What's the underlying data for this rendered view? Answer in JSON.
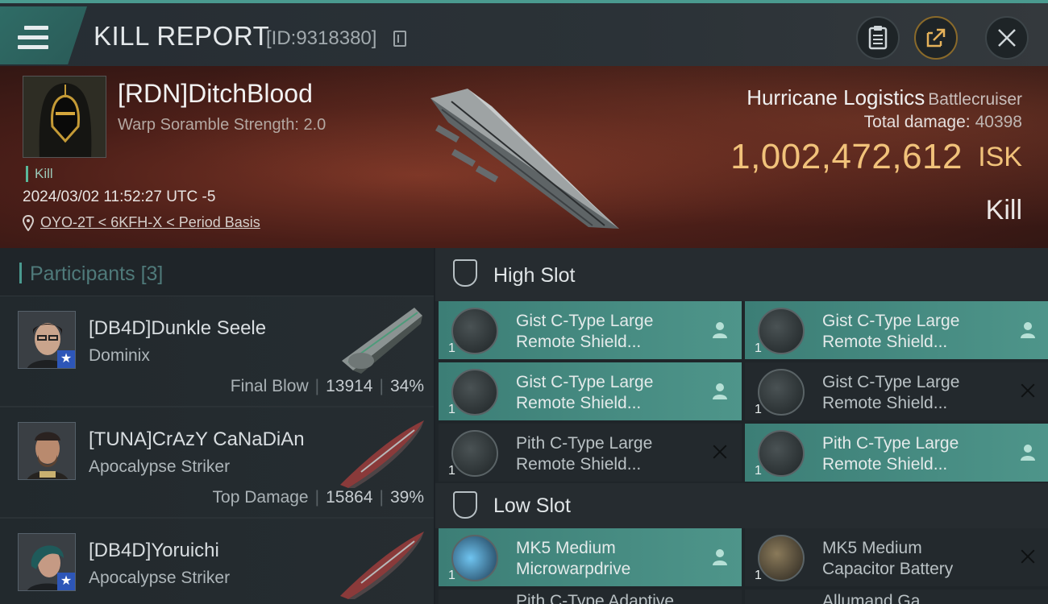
{
  "header": {
    "title": "KILL REPORT",
    "report_id": "[ID:9318380]"
  },
  "victim": {
    "name": "[RDN]DitchBlood",
    "scramble": "Warp Soramble Strength: 2.0",
    "kill_tag": "Kill",
    "datetime": "2024/03/02 11:52:27 UTC -5",
    "location": "OYO-2T < 6KFH-X < Period Basis",
    "ship_name": "Hurricane Logistics",
    "ship_class": "Battlecruiser",
    "total_damage_label": "Total damage:",
    "total_damage": "40398",
    "isk_value": "1,002,472,612",
    "isk_unit": "ISK",
    "result": "Kill"
  },
  "participants": {
    "label": "Participants",
    "count": "[3]",
    "rows": [
      {
        "name": "[DB4D]Dunkle Seele",
        "ship": "Dominix",
        "stat_label": "Final Blow",
        "damage": "13914",
        "percent": "34%"
      },
      {
        "name": "[TUNA]CrAzY CaNaDiAn",
        "ship": "Apocalypse Striker",
        "stat_label": "Top Damage",
        "damage": "15864",
        "percent": "39%"
      },
      {
        "name": "[DB4D]Yoruichi",
        "ship": "Apocalypse Striker"
      }
    ]
  },
  "high_slot": {
    "label": "High Slot",
    "items": [
      {
        "line1": "Gist C-Type Large",
        "line2": "Remote Shield...",
        "qty": "1",
        "state": "on",
        "status": "person-icon"
      },
      {
        "line1": "Gist C-Type Large",
        "line2": "Remote Shield...",
        "qty": "1",
        "state": "on",
        "status": "person-icon"
      },
      {
        "line1": "Gist C-Type Large",
        "line2": "Remote Shield...",
        "qty": "1",
        "state": "on",
        "status": "person-icon"
      },
      {
        "line1": "Gist C-Type Large",
        "line2": "Remote Shield...",
        "qty": "1",
        "state": "off",
        "status": "x-icon"
      },
      {
        "line1": "Pith C-Type Large",
        "line2": "Remote Shield...",
        "qty": "1",
        "state": "off",
        "status": "x-icon"
      },
      {
        "line1": "Pith C-Type Large",
        "line2": "Remote Shield...",
        "qty": "1",
        "state": "on",
        "status": "person-icon"
      }
    ]
  },
  "low_slot": {
    "label": "Low Slot",
    "items": [
      {
        "line1": "MK5 Medium",
        "line2": "Microwarpdrive",
        "qty": "1",
        "state": "on",
        "status": "person-icon"
      },
      {
        "line1": "MK5 Medium",
        "line2": "Capacitor Battery",
        "qty": "1",
        "state": "off",
        "status": "x-icon"
      }
    ],
    "partial": [
      "Pith C-Type Adaptive",
      "Allumand Ga..."
    ]
  },
  "colors": {
    "accent": "#4a9a8f",
    "isk": "#f1c27a",
    "item_on": "#4e958a"
  }
}
